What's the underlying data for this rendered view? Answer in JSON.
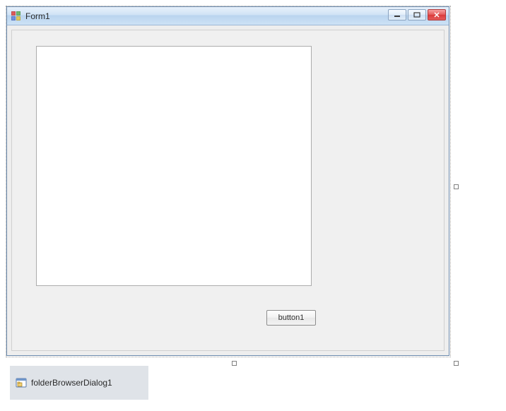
{
  "window": {
    "title": "Form1"
  },
  "controls": {
    "button1_text": "button1"
  },
  "componentTray": {
    "item1_name": "folderBrowserDialog1"
  }
}
